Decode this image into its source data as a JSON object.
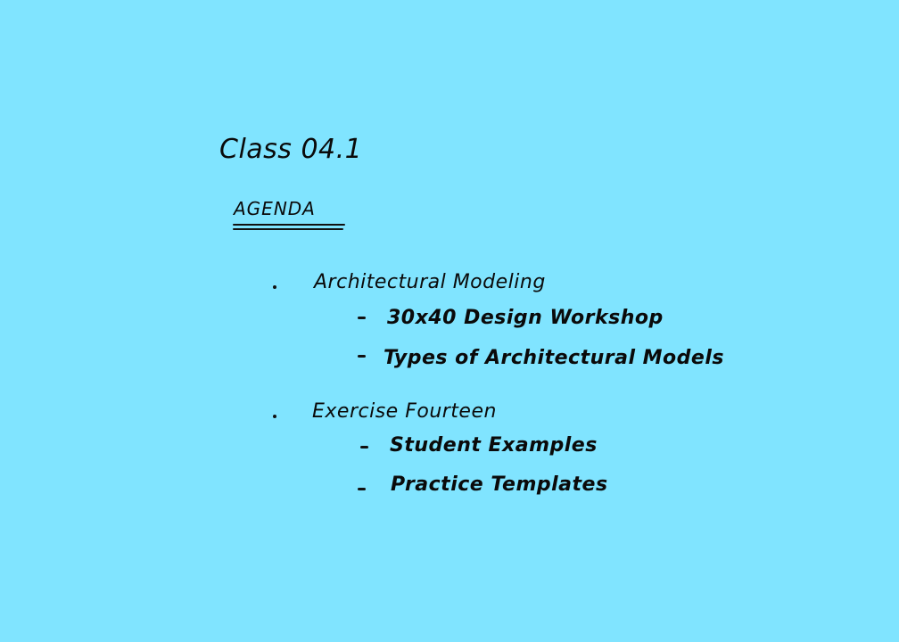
{
  "title": "Class 04.1",
  "agenda_heading": "AGENDA",
  "items": [
    {
      "label": "Architectural Modeling",
      "subitems": [
        "30x40 Design Workshop",
        "Types of Architectural Models"
      ]
    },
    {
      "label": "Exercise Fourteen",
      "subitems": [
        "Student Examples",
        "Practice Templates"
      ]
    }
  ],
  "colors": {
    "background": "#80e4ff",
    "ink": "#0a0a0a"
  }
}
